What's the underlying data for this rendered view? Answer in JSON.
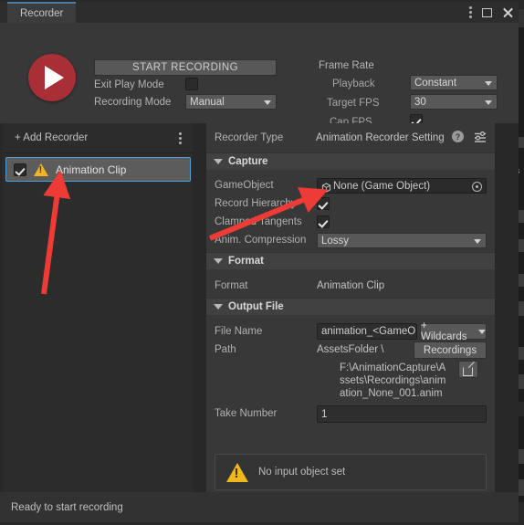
{
  "window": {
    "tab_label": "Recorder",
    "controls": [
      {
        "name": "menu-dots-icon",
        "label": "⋮"
      },
      {
        "name": "maximize-icon",
        "label": "□"
      },
      {
        "name": "close-icon",
        "label": "✕"
      }
    ]
  },
  "top": {
    "record_button_icon": "play-icon",
    "start_recording_label": "START RECORDING",
    "exit_play_mode_label": "Exit Play Mode",
    "exit_play_mode_checked": false,
    "recording_mode_label": "Recording Mode",
    "recording_mode_value": "Manual",
    "frame_rate_title": "Frame Rate",
    "playback_label": "Playback",
    "playback_value": "Constant",
    "target_fps_label": "Target FPS",
    "target_fps_value": "30",
    "cap_fps_label": "Cap FPS",
    "cap_fps_checked": true
  },
  "recorder_list": {
    "add_label": "+ Add Recorder",
    "menu_icon": "menu-dots-icon",
    "items": [
      {
        "label": "Animation Clip",
        "enabled": true,
        "has_warning": true,
        "selected": true
      }
    ]
  },
  "settings": {
    "recorder_type_label": "Recorder Type",
    "recorder_type_value": "Animation Recorder Setting",
    "help_icon": "help-icon",
    "preset_icon": "preset-icon",
    "capture": {
      "header": "Capture",
      "gameobject_label": "GameObject",
      "gameobject_value": "None (Game Object)",
      "gameobject_icon": "cube-icon",
      "object_picker_icon": "object-picker-icon",
      "record_hierarchy_label": "Record Hierarchy",
      "record_hierarchy_checked": true,
      "clamped_tangents_label": "Clamped Tangents",
      "clamped_tangents_checked": true,
      "anim_compression_label": "Anim. Compression",
      "anim_compression_value": "Lossy"
    },
    "format": {
      "header": "Format",
      "format_label": "Format",
      "format_value": "Animation Clip"
    },
    "output_file": {
      "header": "Output File",
      "file_name_label": "File Name",
      "file_name_value": "animation_<GameObject>",
      "wildcards_label": "+ Wildcards",
      "path_label": "Path",
      "path_root_value": "AssetsFolder \\",
      "path_folder_value": "Recordings",
      "full_path": "F:\\AnimationCapture\\Assets\\Recordings\\animation_None_001.anim",
      "open_folder_icon": "open-folder-icon",
      "take_number_label": "Take Number",
      "take_number_value": "1"
    },
    "warning": {
      "icon": "warning-triangle-icon",
      "message": "No input object set"
    }
  },
  "status_bar": {
    "message": "Ready to start recording"
  },
  "annotations": {
    "arrow_color": "#ef3b35",
    "arrows": [
      {
        "name": "arrow-to-animation-clip-item"
      },
      {
        "name": "arrow-to-gameobject-field"
      }
    ]
  },
  "colors": {
    "accent_blue": "#4d7ea8",
    "selection_border": "#4f9fd4",
    "record_red": "#a82f36",
    "warning_yellow": "#f0b71d",
    "panel_bg": "#383838",
    "list_bg": "#2c2c2c"
  }
}
